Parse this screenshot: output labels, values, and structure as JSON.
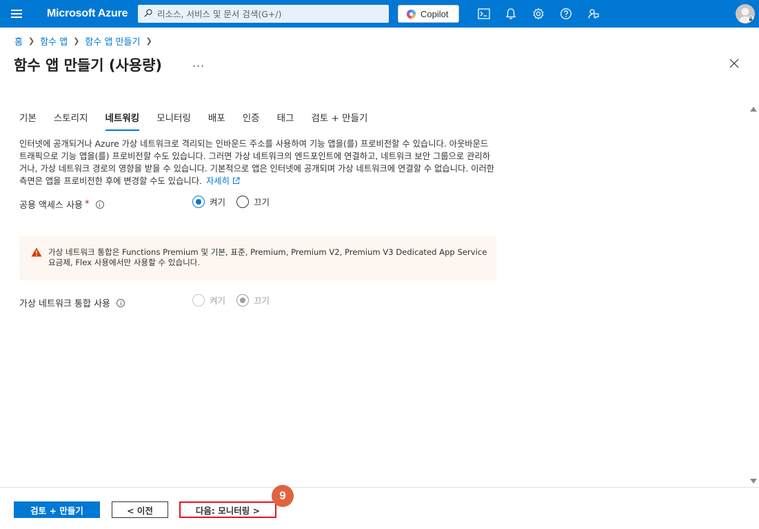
{
  "topbar": {
    "brand": "Microsoft Azure",
    "search_placeholder": "리소스, 서비스 및 문서 검색(G+/)",
    "copilot_label": "Copilot",
    "icons": [
      "cloud-shell-icon",
      "bell-icon",
      "gear-icon",
      "help-icon",
      "feedback-icon"
    ]
  },
  "breadcrumb": [
    "홈",
    "함수 앱",
    "함수 앱 만들기"
  ],
  "page": {
    "title": "함수 앱 만들기 (사용량)",
    "more": "..."
  },
  "tabs": [
    {
      "label": "기본",
      "active": false
    },
    {
      "label": "스토리지",
      "active": false
    },
    {
      "label": "네트워킹",
      "active": true
    },
    {
      "label": "모니터링",
      "active": false
    },
    {
      "label": "배포",
      "active": false
    },
    {
      "label": "인증",
      "active": false
    },
    {
      "label": "태그",
      "active": false
    },
    {
      "label": "검토 + 만들기",
      "active": false
    }
  ],
  "description": {
    "text": "인터넷에 공개되거나 Azure 가상 네트워크로 격리되는 인바운드 주소를 사용하여 기능 앱을(를) 프로비전할 수 있습니다. 아웃바운드 트래픽으로 기능 앱을(를) 프로비전할 수도 있습니다. 그러면 가상 네트워크의 엔드포인트에 연결하고, 네트워크 보안 그룹으로 관리하거나, 가상 네트워크 경로의 영향을 받을 수 있습니다. 기본적으로 앱은 인터넷에 공개되며 가상 네트워크에 연결할 수 없습니다. 이러한 측면은 앱을 프로비전한 후에 변경할 수도 있습니다.",
    "link": "자세히"
  },
  "public_access": {
    "label": "공용 액세스 사용",
    "required_mark": "*",
    "on_label": "켜기",
    "off_label": "끄기",
    "selected": "on"
  },
  "warning": {
    "text": "가상 네트워크 통합은 Functions Premium 및 기본, 표준, Premium, Premium V2, Premium V3 Dedicated App Service 요금제, Flex 사용에서만 사용할 수 있습니다."
  },
  "vnet_integration": {
    "label": "가상 네트워크 통합 사용",
    "on_label": "켜기",
    "off_label": "끄기",
    "selected": "off",
    "disabled": true
  },
  "footer": {
    "review_create": "검토 + 만들기",
    "previous": "< 이전",
    "next": "다음: 모니터링 >",
    "step_badge": "9"
  },
  "colors": {
    "accent": "#0078d4",
    "warning_bg": "#fdf6f1",
    "warning_icon": "#d83b01",
    "highlight_border": "#e81123",
    "badge": "#e0633f"
  }
}
